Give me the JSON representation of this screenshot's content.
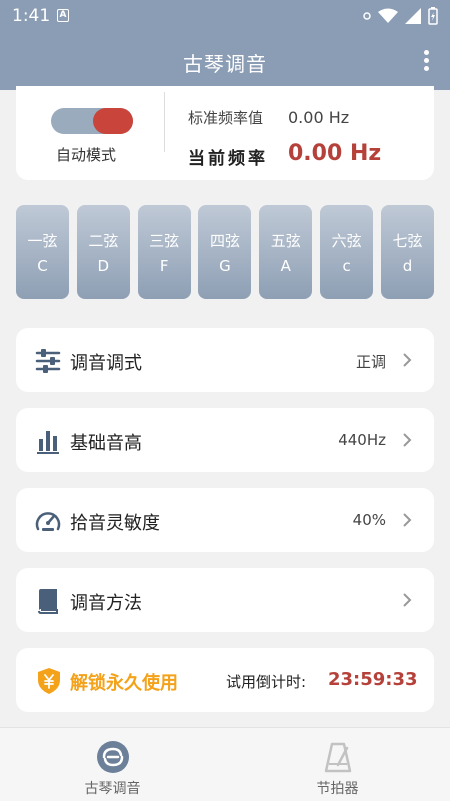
{
  "status_bar": {
    "time": "1:41",
    "notif_letter": "A"
  },
  "app_bar": {
    "title": "古琴调音"
  },
  "tuner": {
    "mode_label": "自动模式",
    "mode_on": true,
    "std_freq_label": "标准频率值",
    "std_freq_value": "0.00 Hz",
    "current_freq_label": "当前频率",
    "current_freq_value": "0.00 Hz"
  },
  "strings": [
    {
      "name": "一弦",
      "note": "C"
    },
    {
      "name": "二弦",
      "note": "D"
    },
    {
      "name": "三弦",
      "note": "F"
    },
    {
      "name": "四弦",
      "note": "G"
    },
    {
      "name": "五弦",
      "note": "A"
    },
    {
      "name": "六弦",
      "note": "c"
    },
    {
      "name": "七弦",
      "note": "d"
    }
  ],
  "settings": [
    {
      "label": "调音调式",
      "value": "正调",
      "icon": "sliders-icon"
    },
    {
      "label": "基础音高",
      "value": "440Hz",
      "icon": "bar-chart-icon"
    },
    {
      "label": "拾音灵敏度",
      "value": "40%",
      "icon": "gauge-icon"
    },
    {
      "label": "调音方法",
      "value": "",
      "icon": "book-icon"
    }
  ],
  "unlock": {
    "label": "解锁永久使用",
    "trial_label": "试用倒计时:",
    "trial_time": "23:59:33",
    "icon": "yuan-shield-icon"
  },
  "bottom_nav": {
    "items": [
      {
        "label": "古琴调音",
        "icon": "tuner-icon",
        "active": true
      },
      {
        "label": "节拍器",
        "icon": "metronome-icon",
        "active": false
      }
    ]
  },
  "colors": {
    "primary": "#8b9db4",
    "accent_red": "#b5413a",
    "unlock_orange": "#f3a21a",
    "background": "#f1f1f1"
  }
}
